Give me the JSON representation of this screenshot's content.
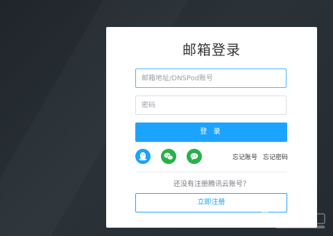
{
  "login": {
    "title": "邮箱登录",
    "email_placeholder": "邮箱地址/DNSPod账号",
    "password_placeholder": "密码",
    "login_button": "登 录",
    "forgot_account": "忘记账号",
    "forgot_password": "忘记密码",
    "register_hint": "还没有注册腾讯云账号？",
    "register_button": "立即注册",
    "social_logins": [
      {
        "icon": "qq-icon",
        "color": "#1ba4ff"
      },
      {
        "icon": "wechat-icon",
        "color": "#26b24a"
      },
      {
        "icon": "wecom-icon",
        "color": "#26b24a"
      }
    ]
  },
  "colors": {
    "background": "#262d33",
    "primary": "#1ba4ff",
    "social_green": "#26b24a"
  }
}
